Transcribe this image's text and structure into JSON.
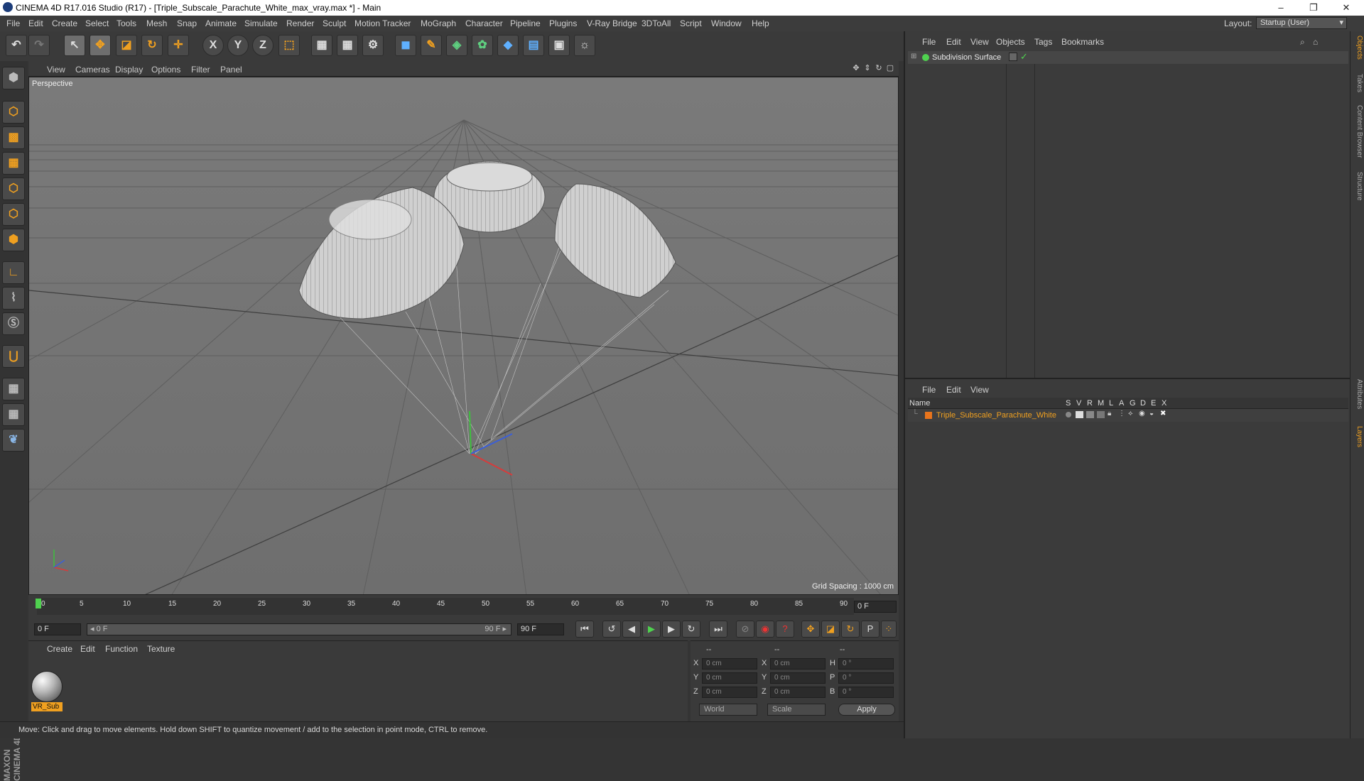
{
  "window": {
    "title": "CINEMA 4D R17.016 Studio (R17) - [Triple_Subscale_Parachute_White_max_vray.max *] - Main",
    "controls": [
      "–",
      "❐",
      "✕"
    ]
  },
  "menubar": {
    "items": [
      "File",
      "Edit",
      "Create",
      "Select",
      "Tools",
      "Mesh",
      "Snap",
      "Animate",
      "Simulate",
      "Render",
      "Sculpt",
      "Motion Tracker",
      "MoGraph",
      "Character",
      "Pipeline",
      "Plugins",
      "V-Ray Bridge",
      "3DToAll",
      "Script",
      "Window",
      "Help"
    ],
    "layout_label": "Layout:",
    "layout_value": "Startup (User)"
  },
  "toolbar": {
    "icons": [
      "undo-icon",
      "redo-icon",
      "live-selection-icon",
      "move-icon",
      "scale-icon",
      "rotate-icon",
      "recent-tool-icon",
      "x-axis-icon",
      "y-axis-icon",
      "z-axis-icon",
      "coordinate-system-icon",
      "render-view-icon",
      "render-picture-viewer-icon",
      "render-settings-icon",
      "cube-icon",
      "pen-spline-icon",
      "subdivision-surface-icon",
      "cloner-icon",
      "deformer-icon",
      "floor-icon",
      "camera-icon",
      "light-icon"
    ],
    "axis_labels": [
      "X",
      "Y",
      "Z"
    ]
  },
  "left_tools": [
    "make-editable-icon",
    "model-mode-icon",
    "texture-mode-icon",
    "workplane-mode-icon",
    "points-mode-icon",
    "edges-mode-icon",
    "polygons-mode-icon",
    "axis-mode-icon",
    "tweak-mode-icon",
    "solo-icon",
    "magnet-icon",
    "snap-grid-icon",
    "snap-settings-icon",
    "python-icon"
  ],
  "viewport": {
    "menu": [
      "View",
      "Cameras",
      "Display",
      "Options",
      "Filter",
      "Panel"
    ],
    "label": "Perspective",
    "grid_spacing": "Grid Spacing : 1000 cm"
  },
  "timeline": {
    "ticks": [
      "0",
      "5",
      "10",
      "15",
      "20",
      "25",
      "30",
      "35",
      "40",
      "45",
      "50",
      "55",
      "60",
      "65",
      "70",
      "75",
      "80",
      "85",
      "90"
    ],
    "current_frame": "0 F"
  },
  "transport": {
    "start_field": "0 F",
    "slider_start": "◂ 0 F",
    "slider_end": "90 F ▸",
    "end_field": "90 F"
  },
  "material_manager": {
    "menu": [
      "Create",
      "Edit",
      "Function",
      "Texture"
    ],
    "material_name": "VR_Sub"
  },
  "coordinates": {
    "headers": [
      "--",
      "--",
      "--"
    ],
    "rows": [
      {
        "l1": "X",
        "v1": "0 cm",
        "l2": "X",
        "v2": "0 cm",
        "l3": "H",
        "v3": "0 °"
      },
      {
        "l1": "Y",
        "v1": "0 cm",
        "l2": "Y",
        "v2": "0 cm",
        "l3": "P",
        "v3": "0 °"
      },
      {
        "l1": "Z",
        "v1": "0 cm",
        "l2": "Z",
        "v2": "0 cm",
        "l3": "B",
        "v3": "0 °"
      }
    ],
    "mode_world": "World",
    "mode_scale": "Scale",
    "apply": "Apply"
  },
  "object_manager": {
    "menu": [
      "File",
      "Edit",
      "View",
      "Objects",
      "Tags",
      "Bookmarks"
    ],
    "object_name": "Subdivision Surface"
  },
  "layer_manager": {
    "menu": [
      "File",
      "Edit",
      "View"
    ],
    "name_header": "Name",
    "flags": [
      "S",
      "V",
      "R",
      "M",
      "L",
      "A",
      "G",
      "D",
      "E",
      "X"
    ],
    "layer_name": "Triple_Subscale_Parachute_White",
    "layer_color": "#e8741c"
  },
  "side_tabs": [
    "Objects",
    "Takes",
    "Content Browser",
    "Structure",
    "Attributes",
    "Layers"
  ],
  "status": {
    "text": "Move: Click and drag to move elements. Hold down SHIFT to quantize movement / add to the selection in point mode, CTRL to remove."
  },
  "branding": {
    "logo_text": "MAXON CINEMA 4D"
  },
  "colors": {
    "accent": "#f0a020",
    "viewport_bg": "#747474",
    "panel_bg": "#3b3b3b"
  }
}
